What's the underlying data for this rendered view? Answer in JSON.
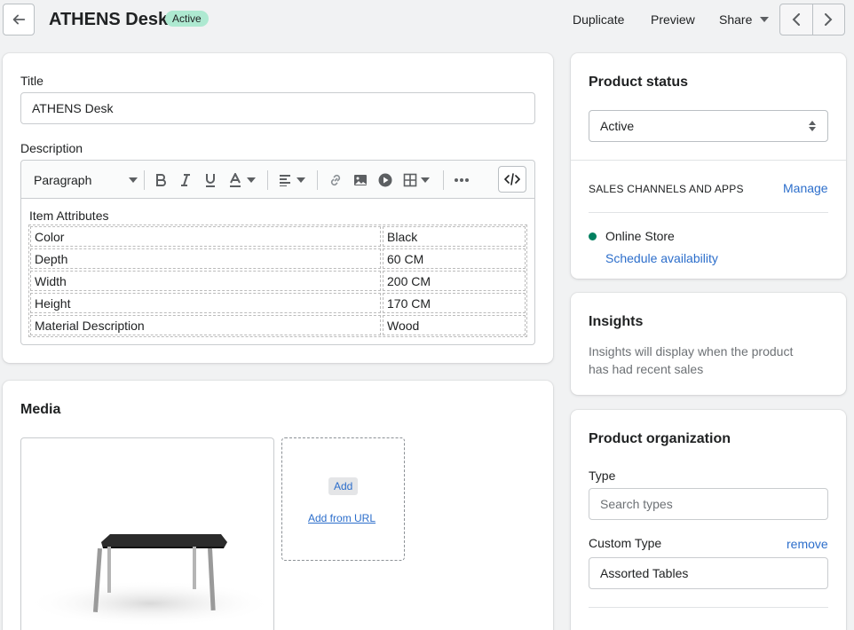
{
  "header": {
    "back_icon": "arrow-left-icon",
    "title": "ATHENS Desk",
    "status_badge": "Active",
    "actions": {
      "duplicate": "Duplicate",
      "preview": "Preview",
      "share": "Share"
    }
  },
  "product": {
    "title_label": "Title",
    "title_value": "ATHENS Desk",
    "description_label": "Description",
    "toolbar": {
      "paragraph": "Paragraph"
    },
    "description": {
      "heading": "Item Attributes",
      "rows": [
        {
          "key": "Color",
          "value": "Black"
        },
        {
          "key": "Depth",
          "value": "60 CM"
        },
        {
          "key": "Width",
          "value": "200 CM"
        },
        {
          "key": "Height",
          "value": "170 CM"
        },
        {
          "key": "Material Description",
          "value": "Wood"
        }
      ]
    }
  },
  "media": {
    "title": "Media",
    "add_label": "Add",
    "add_url_label": "Add from URL"
  },
  "status_card": {
    "title": "Product status",
    "selected": "Active",
    "channels_heading": "SALES CHANNELS AND APPS",
    "manage_label": "Manage",
    "channel_name": "Online Store",
    "channel_dot_color": "#007f5f",
    "schedule_label": "Schedule availability"
  },
  "insights": {
    "title": "Insights",
    "text_line1": "Insights will display when the product",
    "text_line2": "has had recent sales"
  },
  "organization": {
    "title": "Product organization",
    "type_label": "Type",
    "type_placeholder": "Search types",
    "custom_type_label": "Custom Type",
    "remove_label": "remove",
    "custom_type_value": "Assorted Tables"
  }
}
